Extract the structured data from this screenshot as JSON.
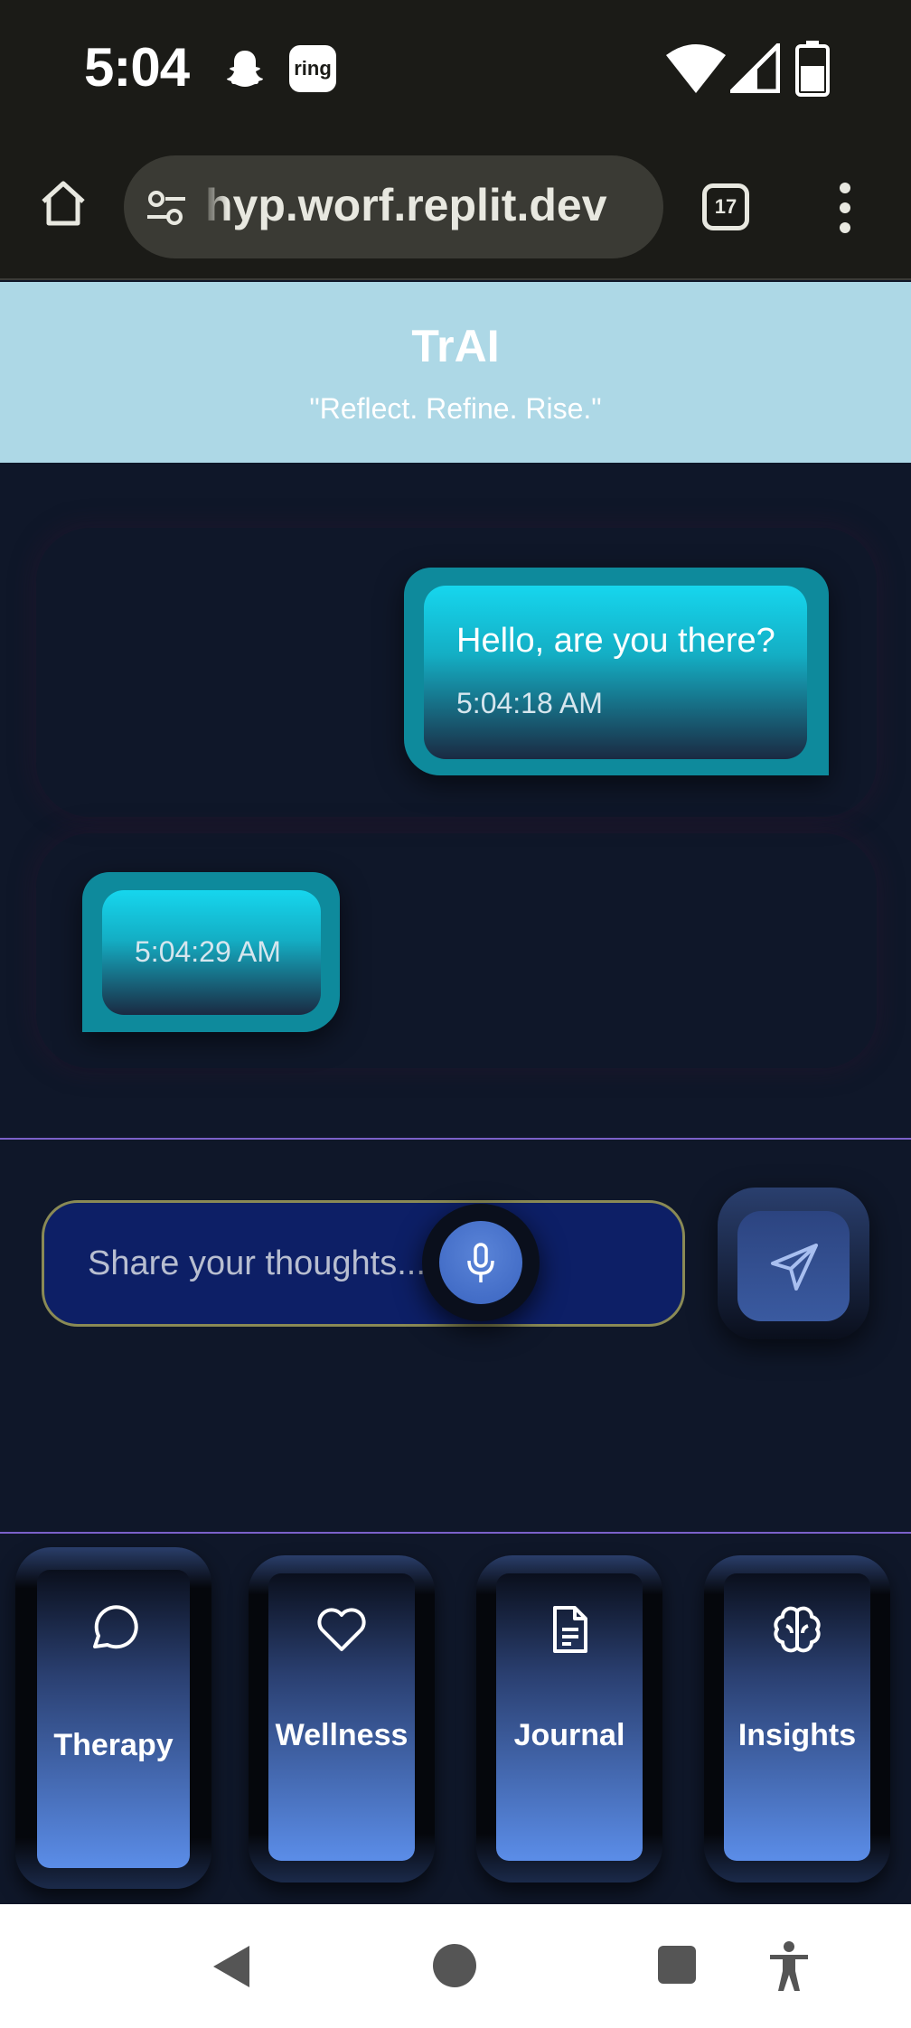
{
  "status_bar": {
    "time": "5:04",
    "ring_label": "ring",
    "icons": [
      "snapchat-icon",
      "ring-icon",
      "wifi-icon",
      "signal-icon",
      "battery-icon"
    ]
  },
  "browser": {
    "url": "hyp.worf.replit.dev",
    "tab_count": "17",
    "icons": [
      "home-icon",
      "site-settings-icon",
      "tabs-icon",
      "more-menu-icon"
    ]
  },
  "app": {
    "title": "TrAI",
    "tagline": "\"Reflect. Refine. Rise.\""
  },
  "chat": {
    "messages": [
      {
        "role": "user",
        "text": "Hello, are you there?",
        "time": "5:04:18 AM"
      },
      {
        "role": "assistant",
        "text": "",
        "time": "5:04:29 AM"
      }
    ]
  },
  "composer": {
    "placeholder": "Share your thoughts...",
    "icons": [
      "microphone-icon",
      "send-icon"
    ]
  },
  "nav": {
    "tabs": [
      {
        "label": "Therapy",
        "icon": "chat-bubble-icon",
        "active": true
      },
      {
        "label": "Wellness",
        "icon": "heart-icon"
      },
      {
        "label": "Journal",
        "icon": "document-icon"
      },
      {
        "label": "Insights",
        "icon": "brain-icon"
      }
    ]
  },
  "colors": {
    "header_bg": "#add8e6",
    "page_bg": "#0f1729",
    "bubble_accent": "#16d6ee",
    "divider": "#7b61c9",
    "input_bg": "#0d1f66"
  }
}
